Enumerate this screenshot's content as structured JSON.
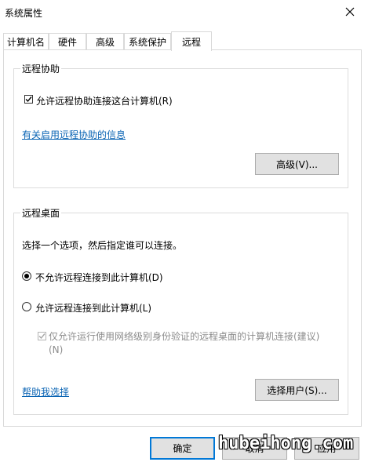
{
  "window": {
    "title": "系统属性"
  },
  "tabs": [
    {
      "label": "计算机名"
    },
    {
      "label": "硬件"
    },
    {
      "label": "高级"
    },
    {
      "label": "系统保护"
    },
    {
      "label": "远程"
    }
  ],
  "remote_assistance": {
    "title": "远程协助",
    "allow_label": "允许远程协助连接这台计算机(R)",
    "allow_checked": true,
    "info_link": "有关启用远程协助的信息",
    "advanced_button": "高级(V)..."
  },
  "remote_desktop": {
    "title": "远程桌面",
    "instruction": "选择一个选项，然后指定谁可以连接。",
    "option_disallow": "不允许远程连接到此计算机(D)",
    "option_allow": "允许远程连接到此计算机(L)",
    "selected": "option_disallow",
    "nla_label": "仅允许运行使用网络级别身份验证的远程桌面的计算机连接(建议)(N)",
    "help_link": "帮助我选择",
    "select_users_button": "选择用户(S)..."
  },
  "footer": {
    "ok_button": "确定",
    "cancel_button": "取消",
    "apply_button": "应用"
  },
  "watermark": "hubeihong.com"
}
